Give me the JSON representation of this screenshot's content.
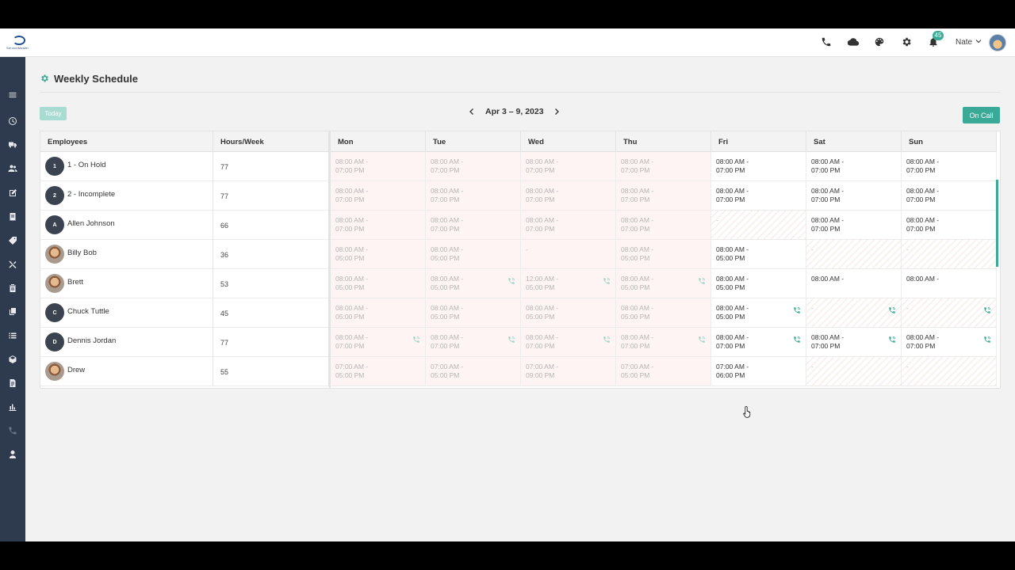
{
  "logo": {
    "text": "ServiceMaster"
  },
  "topbar": {
    "icons": [
      "phone-icon",
      "cloud-icon",
      "palette-icon",
      "gear-icon",
      "bell-icon"
    ],
    "notification_count": "45",
    "user_name": "Nate"
  },
  "sidebar": {
    "items": [
      "menu-icon",
      "clock-icon",
      "truck-icon",
      "users-icon",
      "edit-icon",
      "receipt-icon",
      "tag-icon",
      "tools-icon",
      "clipboard-icon",
      "copy-icon",
      "list-icon",
      "box-icon",
      "document-icon",
      "chart-icon",
      "phone-icon",
      "person-icon"
    ]
  },
  "page": {
    "title": "Weekly Schedule",
    "today_label": "Today",
    "date_range": "Apr 3 – 9, 2023",
    "oncall_label": "On Call"
  },
  "table": {
    "col_employees": "Employees",
    "col_hours": "Hours/Week",
    "days": [
      "Mon",
      "Tue",
      "Wed",
      "Thu",
      "Fri",
      "Sat",
      "Sun"
    ],
    "rows": [
      {
        "initial": "1",
        "name": "1 - On Hold",
        "hours": "77",
        "photo": false,
        "shifts": [
          [
            "08:00 AM -",
            "07:00 PM"
          ],
          [
            "08:00 AM -",
            "07:00 PM"
          ],
          [
            "08:00 AM -",
            "07:00 PM"
          ],
          [
            "08:00 AM -",
            "07:00 PM"
          ],
          [
            "08:00 AM -",
            "07:00 PM"
          ],
          [
            "08:00 AM -",
            "07:00 PM"
          ],
          [
            "08:00 AM -",
            "07:00 PM"
          ]
        ],
        "status": [
          "past",
          "past",
          "past",
          "past",
          "future",
          "future",
          "future"
        ],
        "oncall": [
          false,
          false,
          false,
          false,
          false,
          false,
          false
        ]
      },
      {
        "initial": "2",
        "name": "2 - Incomplete",
        "hours": "77",
        "photo": false,
        "shifts": [
          [
            "08:00 AM -",
            "07:00 PM"
          ],
          [
            "08:00 AM -",
            "07:00 PM"
          ],
          [
            "08:00 AM -",
            "07:00 PM"
          ],
          [
            "08:00 AM -",
            "07:00 PM"
          ],
          [
            "08:00 AM -",
            "07:00 PM"
          ],
          [
            "08:00 AM -",
            "07:00 PM"
          ],
          [
            "08:00 AM -",
            "07:00 PM"
          ]
        ],
        "status": [
          "past",
          "past",
          "past",
          "past",
          "future",
          "future",
          "future"
        ],
        "oncall": [
          false,
          false,
          false,
          false,
          false,
          false,
          false
        ]
      },
      {
        "initial": "A",
        "name": "Allen Johnson",
        "hours": "66",
        "photo": false,
        "shifts": [
          [
            "08:00 AM -",
            "07:00 PM"
          ],
          [
            "08:00 AM -",
            "07:00 PM"
          ],
          [
            "08:00 AM -",
            "07:00 PM"
          ],
          [
            "08:00 AM -",
            "07:00 PM"
          ],
          [
            "-",
            ""
          ],
          [
            "08:00 AM -",
            "07:00 PM"
          ],
          [
            "08:00 AM -",
            "07:00 PM"
          ]
        ],
        "status": [
          "past",
          "past",
          "past",
          "past",
          "off",
          "future",
          "future"
        ],
        "oncall": [
          false,
          false,
          false,
          false,
          false,
          false,
          false
        ]
      },
      {
        "initial": "",
        "name": "Billy Bob",
        "hours": "36",
        "photo": true,
        "shifts": [
          [
            "08:00 AM -",
            "05:00 PM"
          ],
          [
            "08:00 AM -",
            "05:00 PM"
          ],
          [
            "-",
            ""
          ],
          [
            "08:00 AM -",
            "05:00 PM"
          ],
          [
            "08:00 AM -",
            "05:00 PM"
          ],
          [
            "-",
            ""
          ],
          [
            "-",
            ""
          ]
        ],
        "status": [
          "past",
          "past",
          "off-past",
          "past",
          "future",
          "off",
          "off"
        ],
        "oncall": [
          false,
          false,
          false,
          false,
          false,
          false,
          false
        ]
      },
      {
        "initial": "",
        "name": "Brett",
        "hours": "53",
        "photo": true,
        "shifts": [
          [
            "08:00 AM -",
            "05:00 PM"
          ],
          [
            "08:00 AM -",
            "05:00 PM"
          ],
          [
            "12:00 AM -",
            "05:00 PM"
          ],
          [
            "08:00 AM -",
            "05:00 PM"
          ],
          [
            "08:00 AM -",
            "05:00 PM"
          ],
          [
            "08:00 AM -",
            ""
          ],
          [
            "08:00 AM -",
            ""
          ]
        ],
        "status": [
          "past",
          "past",
          "past",
          "past",
          "future",
          "future",
          "future"
        ],
        "oncall": [
          false,
          true,
          true,
          true,
          false,
          false,
          false
        ]
      },
      {
        "initial": "C",
        "name": "Chuck Tuttle",
        "hours": "45",
        "photo": false,
        "shifts": [
          [
            "08:00 AM -",
            "05:00 PM"
          ],
          [
            "08:00 AM -",
            "05:00 PM"
          ],
          [
            "08:00 AM -",
            "05:00 PM"
          ],
          [
            "08:00 AM -",
            "05:00 PM"
          ],
          [
            "08:00 AM -",
            "05:00 PM"
          ],
          [
            "-",
            ""
          ],
          [
            "-",
            ""
          ]
        ],
        "status": [
          "past",
          "past",
          "past",
          "past",
          "future",
          "off",
          "off"
        ],
        "oncall": [
          false,
          false,
          false,
          false,
          true,
          true,
          true
        ]
      },
      {
        "initial": "D",
        "name": "Dennis Jordan",
        "hours": "77",
        "photo": false,
        "shifts": [
          [
            "08:00 AM -",
            "07:00 PM"
          ],
          [
            "08:00 AM -",
            "07:00 PM"
          ],
          [
            "08:00 AM -",
            "07:00 PM"
          ],
          [
            "08:00 AM -",
            "07:00 PM"
          ],
          [
            "08:00 AM -",
            "07:00 PM"
          ],
          [
            "08:00 AM -",
            "07:00 PM"
          ],
          [
            "08:00 AM -",
            "07:00 PM"
          ]
        ],
        "status": [
          "past",
          "past",
          "past",
          "past",
          "future",
          "future",
          "future"
        ],
        "oncall": [
          true,
          true,
          true,
          true,
          true,
          true,
          true
        ]
      },
      {
        "initial": "",
        "name": "Drew",
        "hours": "55",
        "photo": true,
        "shifts": [
          [
            "07:00 AM -",
            "05:00 PM"
          ],
          [
            "07:00 AM -",
            "05:00 PM"
          ],
          [
            "07:00 AM -",
            "09:00 PM"
          ],
          [
            "07:00 AM -",
            "05:00 PM"
          ],
          [
            "07:00 AM -",
            "06:00 PM"
          ],
          [
            "-",
            ""
          ],
          [
            "-",
            ""
          ]
        ],
        "status": [
          "past",
          "past",
          "past",
          "past",
          "future",
          "off",
          "off"
        ],
        "oncall": [
          false,
          false,
          false,
          false,
          false,
          false,
          false
        ]
      }
    ]
  },
  "colors": {
    "accent": "#3aaa97",
    "sidebar": "#2e3b4e",
    "past_bg": "#fdf4f3"
  }
}
